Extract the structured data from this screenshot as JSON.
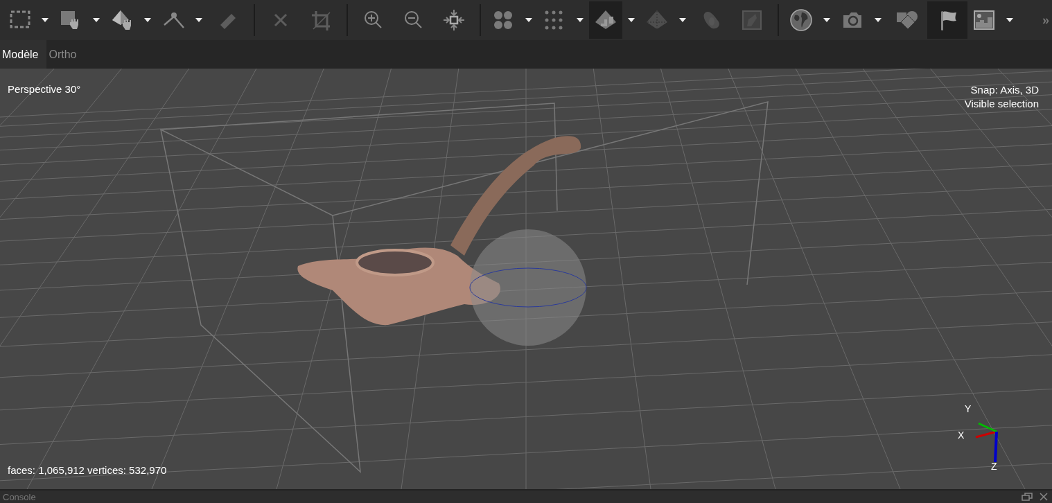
{
  "toolbar": {
    "tools": [
      {
        "kind": "tool",
        "dropdown": true,
        "selected": false,
        "disabled": false
      },
      {
        "kind": "tool",
        "dropdown": true,
        "selected": false,
        "disabled": false
      },
      {
        "kind": "tool",
        "dropdown": true,
        "selected": false,
        "disabled": false
      },
      {
        "kind": "tool",
        "dropdown": true,
        "selected": false,
        "disabled": false
      },
      {
        "kind": "tool",
        "dropdown": false,
        "selected": false,
        "disabled": true
      },
      {
        "kind": "separator"
      },
      {
        "kind": "tool",
        "dropdown": false,
        "selected": false,
        "disabled": true
      },
      {
        "kind": "tool",
        "dropdown": false,
        "selected": false,
        "disabled": true
      },
      {
        "kind": "separator"
      },
      {
        "kind": "tool",
        "dropdown": false,
        "selected": false,
        "disabled": false
      },
      {
        "kind": "tool",
        "dropdown": false,
        "selected": false,
        "disabled": false
      },
      {
        "kind": "tool",
        "dropdown": false,
        "selected": false,
        "disabled": false
      },
      {
        "kind": "separator"
      },
      {
        "kind": "tool",
        "dropdown": true,
        "selected": false,
        "disabled": false
      },
      {
        "kind": "tool",
        "dropdown": true,
        "selected": false,
        "disabled": false
      },
      {
        "kind": "tool",
        "dropdown": true,
        "selected": true,
        "disabled": false
      },
      {
        "kind": "tool",
        "dropdown": true,
        "selected": false,
        "disabled": true
      },
      {
        "kind": "tool",
        "dropdown": false,
        "selected": false,
        "disabled": true
      },
      {
        "kind": "tool",
        "dropdown": false,
        "selected": false,
        "disabled": true
      },
      {
        "kind": "separator"
      },
      {
        "kind": "tool",
        "dropdown": true,
        "selected": false,
        "disabled": false
      },
      {
        "kind": "tool",
        "dropdown": true,
        "selected": false,
        "disabled": false
      },
      {
        "kind": "tool",
        "dropdown": false,
        "selected": false,
        "disabled": false
      },
      {
        "kind": "tool",
        "dropdown": false,
        "selected": true,
        "disabled": false
      },
      {
        "kind": "tool",
        "dropdown": true,
        "selected": false,
        "disabled": false
      }
    ],
    "overflow": "»"
  },
  "tabs": [
    {
      "label": "Modèle",
      "selected": true
    },
    {
      "label": "Ortho",
      "selected": false
    }
  ],
  "viewport": {
    "projection": "Perspective 30°",
    "snap": "Snap: Axis, 3D",
    "selection_mode": "Visible selection",
    "stats": "faces: 1,065,912 vertices: 532,970",
    "axes": {
      "x": "X",
      "y": "Y",
      "z": "Z"
    }
  },
  "console": {
    "title": "Console"
  }
}
